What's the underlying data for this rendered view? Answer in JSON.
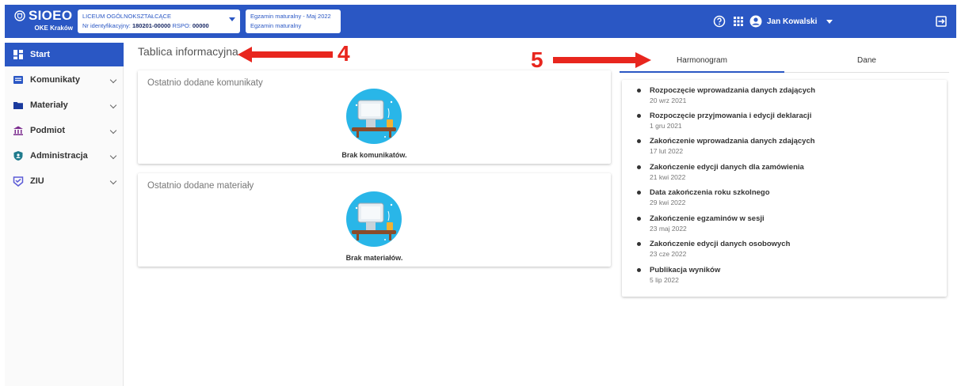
{
  "colors": {
    "primary": "#2a57c4",
    "annotation": "#e8261e",
    "illustration_circle": "#29b6e8"
  },
  "header": {
    "app_name": "SIOEO",
    "org": "OKE Kraków",
    "school": {
      "name": "LICEUM OGÓLNOKSZTAŁCĄCE",
      "id_label": "Nr identyfikacyjny:",
      "id_value": "180201-00000",
      "rspo_label": "RSPO:",
      "rspo_value": "00000"
    },
    "exam": {
      "line1": "Egzamin maturalny - Maj 2022",
      "line2": "Egzamin maturalny"
    },
    "icons": [
      "help-circle-icon",
      "apps-grid-icon",
      "account-circle-icon",
      "logout-icon"
    ],
    "user_name": "Jan Kowalski"
  },
  "sidebar": {
    "items": [
      {
        "label": "Start",
        "icon": "dashboard-icon"
      },
      {
        "label": "Komunikaty",
        "icon": "message-icon"
      },
      {
        "label": "Materiały",
        "icon": "folder-icon"
      },
      {
        "label": "Podmiot",
        "icon": "institution-icon"
      },
      {
        "label": "Administracja",
        "icon": "shield-icon"
      },
      {
        "label": "ZIU",
        "icon": "ziu-icon"
      }
    ]
  },
  "main": {
    "title": "Tablica informacyjna",
    "annotations": [
      "4",
      "5"
    ],
    "cards": [
      {
        "title": "Ostatnio dodane komunikaty",
        "empty_text": "Brak komunikatów."
      },
      {
        "title": "Ostatnio dodane materiały",
        "empty_text": "Brak materiałów."
      }
    ]
  },
  "tabs": [
    {
      "label": "Harmonogram",
      "active": true
    },
    {
      "label": "Dane",
      "active": false
    }
  ],
  "schedule": [
    {
      "title": "Rozpoczęcie wprowadzania danych zdających",
      "date": "20 wrz 2021"
    },
    {
      "title": "Rozpoczęcie przyjmowania i edycji deklaracji",
      "date": "1 gru 2021"
    },
    {
      "title": "Zakończenie wprowadzania danych zdających",
      "date": "17 lut 2022"
    },
    {
      "title": "Zakończenie edycji danych dla zamówienia",
      "date": "21 kwi 2022"
    },
    {
      "title": "Data zakończenia roku szkolnego",
      "date": "29 kwi 2022"
    },
    {
      "title": "Zakończenie egzaminów w sesji",
      "date": "23 maj 2022"
    },
    {
      "title": "Zakończenie edycji danych osobowych",
      "date": "23 cze 2022"
    },
    {
      "title": "Publikacja wyników",
      "date": "5 lip 2022"
    }
  ]
}
